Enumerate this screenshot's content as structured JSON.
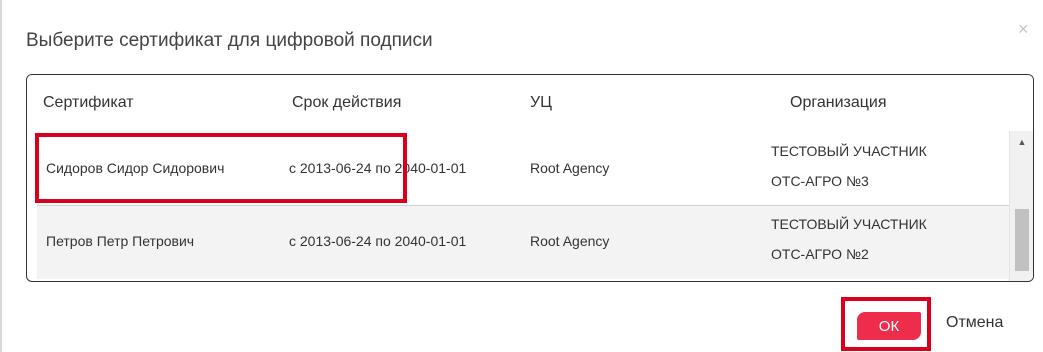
{
  "dialog": {
    "title": "Выберите сертификат для цифровой подписи",
    "close_label": "×"
  },
  "table": {
    "columns": [
      "Сертификат",
      "Срок действия",
      "УЦ",
      "Организация"
    ],
    "rows": [
      {
        "certificate": "Сидоров Сидор Сидорович",
        "validity": "с 2013-06-24 по 2040-01-01",
        "ca": "Root Agency",
        "organization": [
          "ТЕСТОВЫЙ УЧАСТНИК",
          "ОТС-АГРО №3"
        ],
        "selected": true
      },
      {
        "certificate": "Петров Петр Петрович",
        "validity": "с 2013-06-24 по 2040-01-01",
        "ca": "Root Agency",
        "organization": [
          "ТЕСТОВЫЙ УЧАСТНИК",
          "ОТС-АГРО №2"
        ],
        "selected": false
      }
    ],
    "scroll_up_glyph": "▲"
  },
  "buttons": {
    "ok_label": "ОК",
    "cancel_label": "Отмена"
  },
  "colors": {
    "accent": "#ee2d4d",
    "highlight": "#d9001b"
  }
}
